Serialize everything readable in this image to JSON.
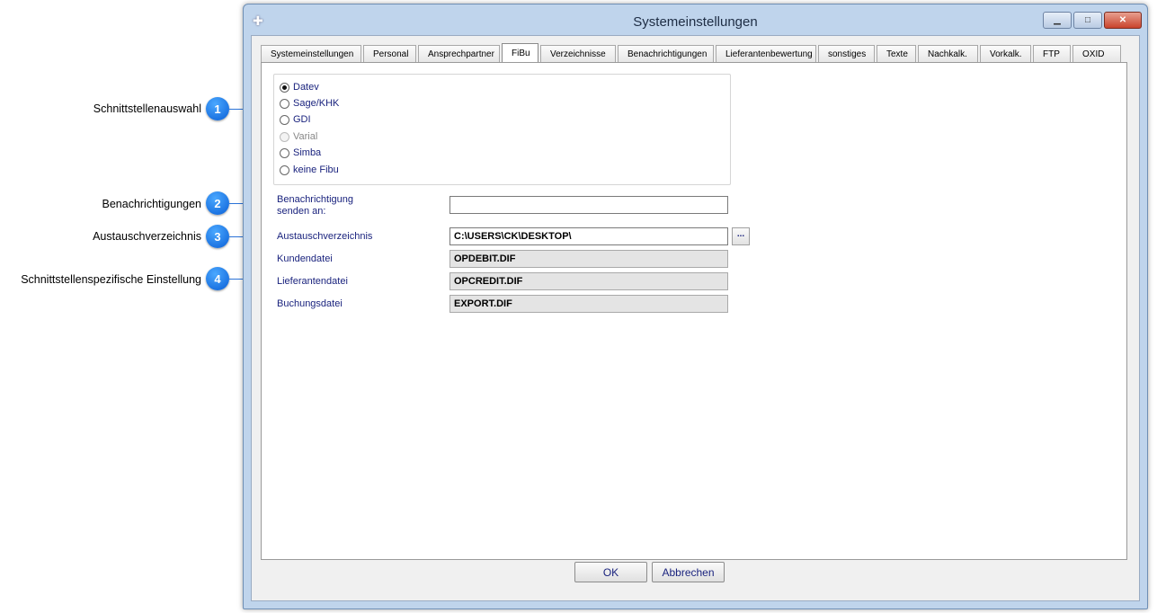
{
  "annotations": [
    {
      "number": "1",
      "label": "Schnittstellenauswahl"
    },
    {
      "number": "2",
      "label": "Benachrichtigungen"
    },
    {
      "number": "3",
      "label": "Austauschverzeichnis"
    },
    {
      "number": "4",
      "label": "Schnittstellenspezifische Einstellung"
    }
  ],
  "window": {
    "title": "Systemeinstellungen",
    "minimize_label": "▁",
    "maximize_label": "□",
    "close_label": "✕"
  },
  "tabs": [
    {
      "label": "Systemeinstellungen"
    },
    {
      "label": "Personal"
    },
    {
      "label": "Ansprechpartner"
    },
    {
      "label": "FiBu"
    },
    {
      "label": "Verzeichnisse"
    },
    {
      "label": "Benachrichtigungen"
    },
    {
      "label": "Lieferantenbewertung"
    },
    {
      "label": "sonstiges"
    },
    {
      "label": "Texte"
    },
    {
      "label": "Nachkalk."
    },
    {
      "label": "Vorkalk."
    },
    {
      "label": "FTP"
    },
    {
      "label": "OXID"
    }
  ],
  "active_tab": "FiBu",
  "fibu": {
    "radios": [
      {
        "label": "Datev",
        "checked": true,
        "disabled": false
      },
      {
        "label": "Sage/KHK",
        "checked": false,
        "disabled": false
      },
      {
        "label": "GDI",
        "checked": false,
        "disabled": false
      },
      {
        "label": "Varial",
        "checked": false,
        "disabled": true
      },
      {
        "label": "Simba",
        "checked": false,
        "disabled": false
      },
      {
        "label": "keine Fibu",
        "checked": false,
        "disabled": false
      }
    ],
    "notify_label_line1": "Benachrichtigung",
    "notify_label_line2": "senden an:",
    "notify_value": "",
    "exchange_dir_label": "Austauschverzeichnis",
    "exchange_dir_value": "C:\\USERS\\CK\\DESKTOP\\",
    "browse_label": "...",
    "customer_file_label": "Kundendatei",
    "customer_file_value": "OPDEBIT.DIF",
    "supplier_file_label": "Lieferantendatei",
    "supplier_file_value": "OPCREDIT.DIF",
    "booking_file_label": "Buchungsdatei",
    "booking_file_value": "EXPORT.DIF"
  },
  "buttons": {
    "ok": "OK",
    "cancel": "Abbrechen"
  },
  "colors": {
    "accent_badge": "#1877e8",
    "label_text": "#1a237e",
    "window_frame": "#bfd4ec"
  }
}
